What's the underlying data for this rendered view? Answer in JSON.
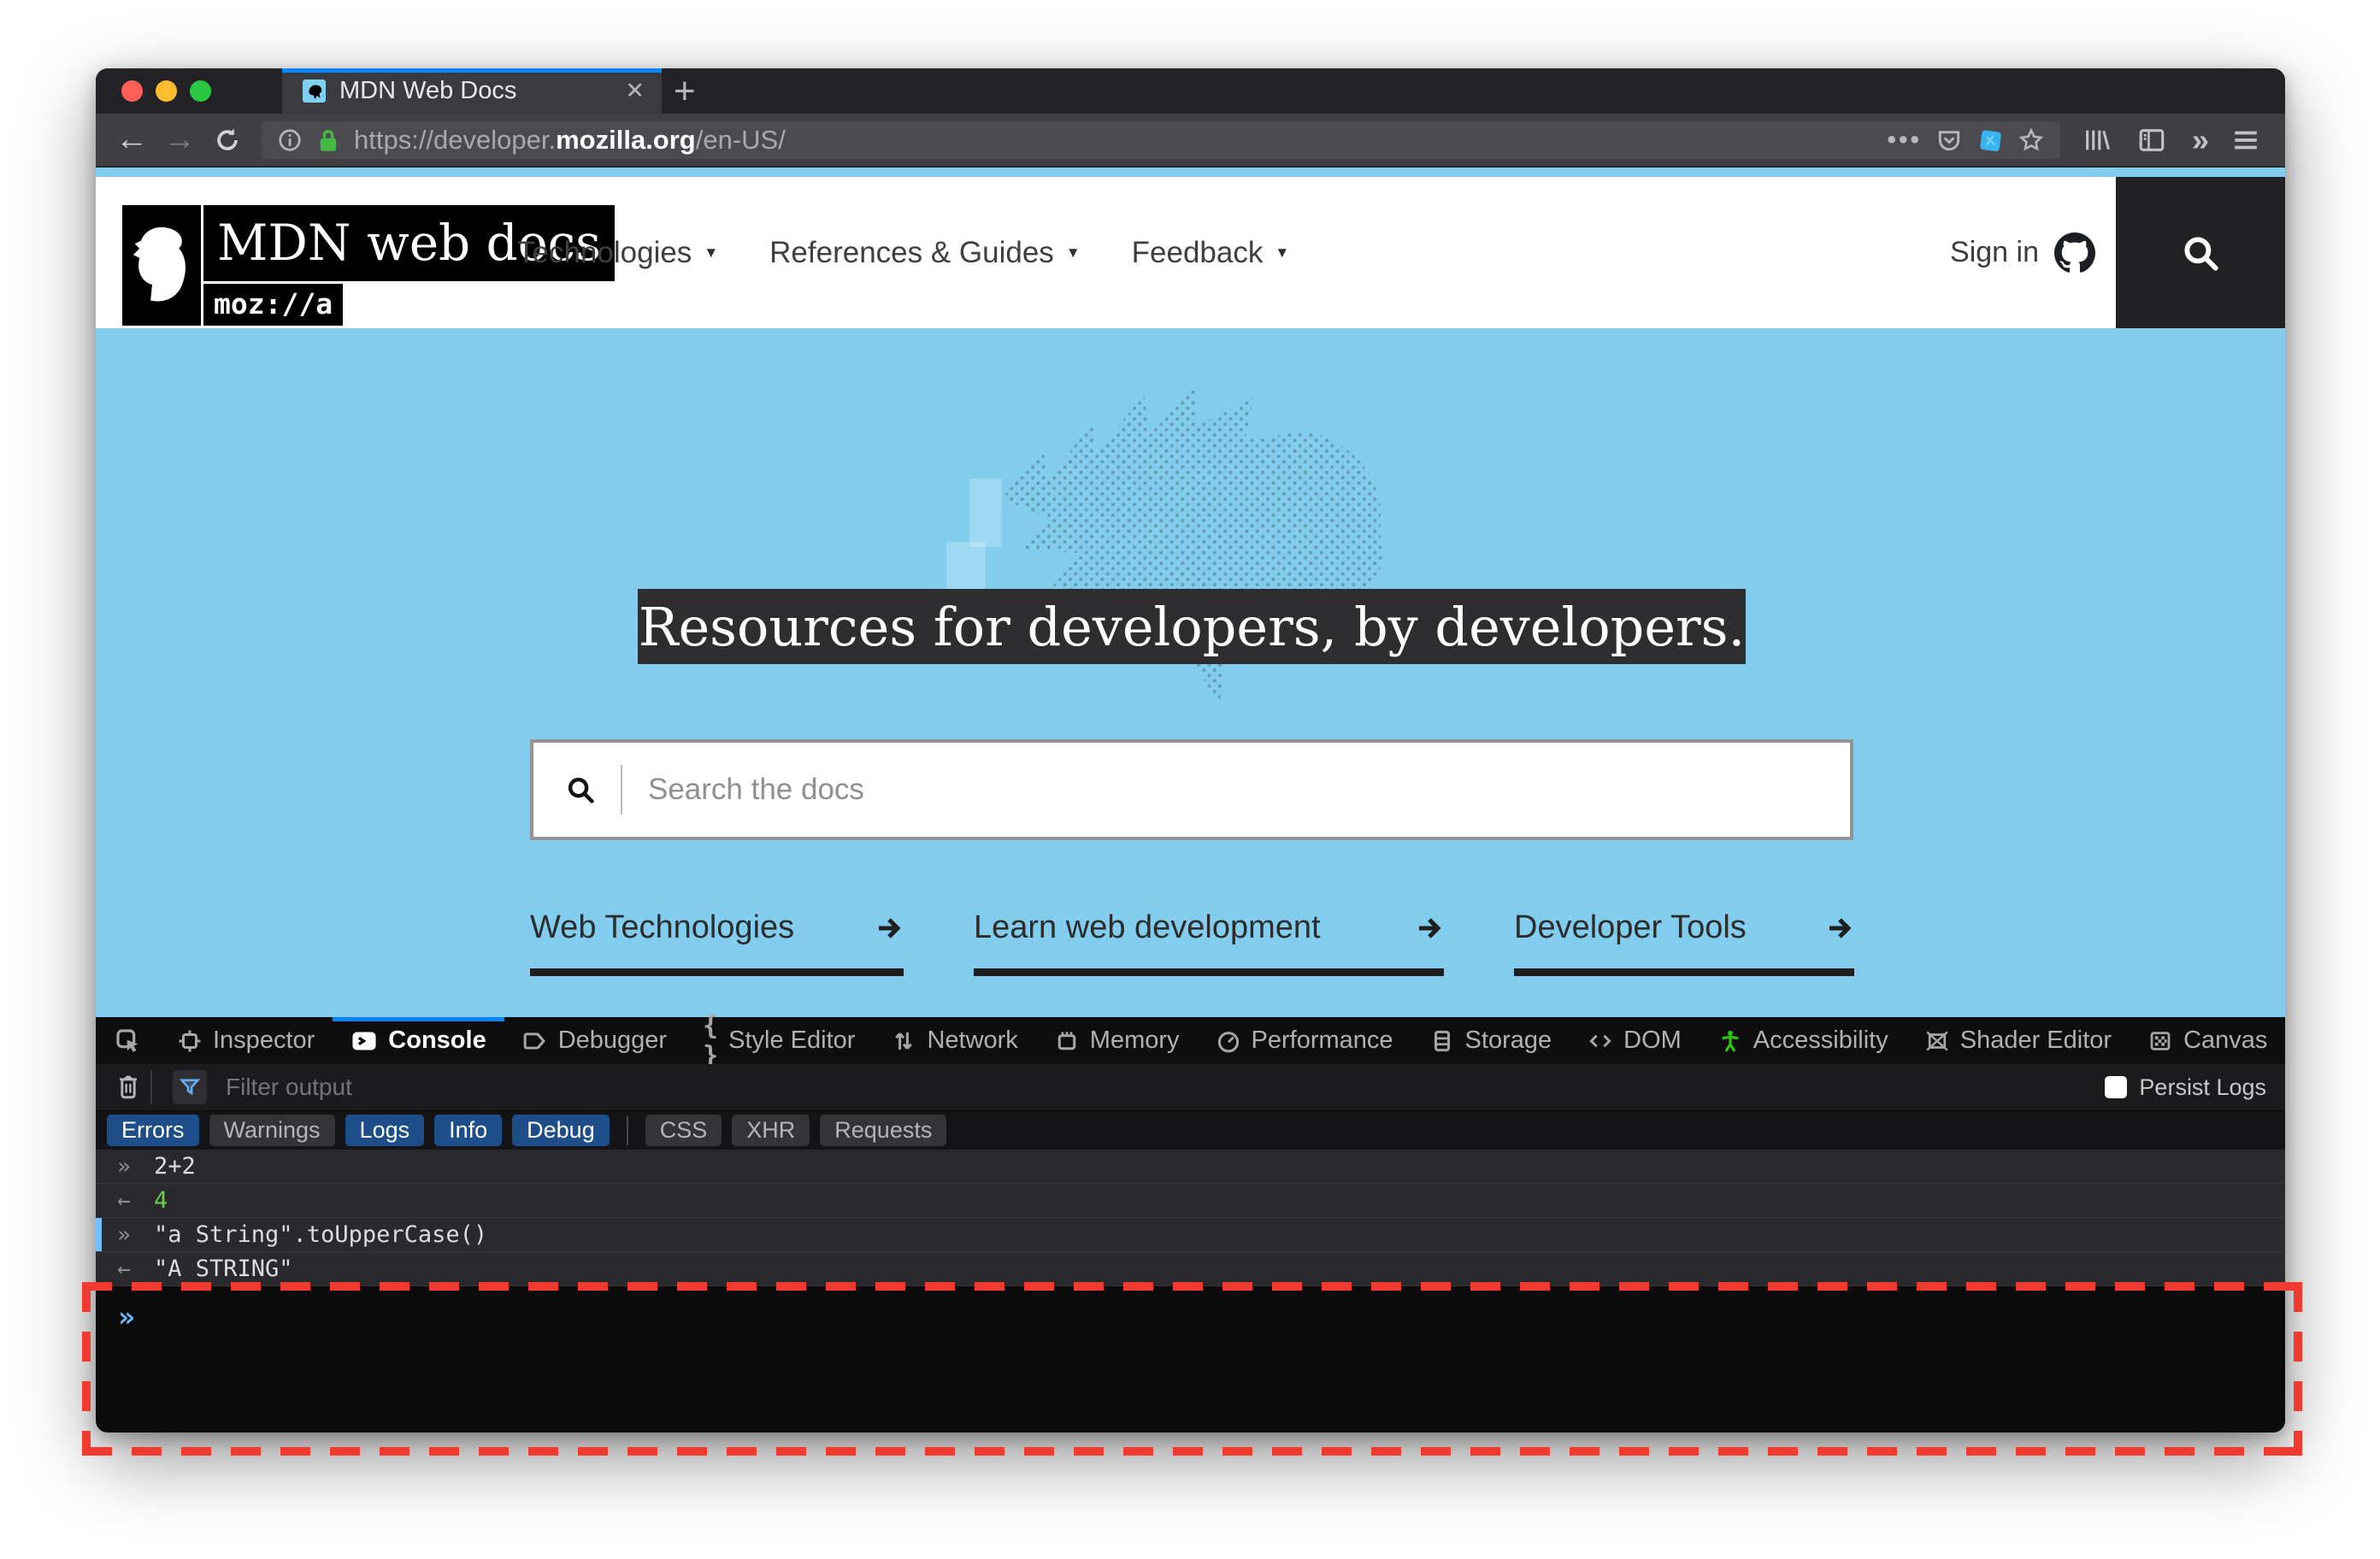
{
  "browser": {
    "tab_title": "MDN Web Docs",
    "tab_close": "✕",
    "new_tab": "+",
    "back": "←",
    "forward": "→",
    "url_scheme": "https://developer.",
    "url_domain": "mozilla.org",
    "url_path": "/en-US/",
    "page_actions_dots": "•••",
    "overflow_chevrons": "»"
  },
  "header": {
    "logo_title": "MDN web docs",
    "logo_sub": "moz://a",
    "caret": "▼",
    "nav": [
      {
        "label": "Technologies"
      },
      {
        "label": "References & Guides"
      },
      {
        "label": "Feedback"
      }
    ],
    "sign_in": "Sign in"
  },
  "hero": {
    "title": "Resources for developers, by developers.",
    "search_placeholder": "Search the docs",
    "links": [
      {
        "label": "Web Technologies"
      },
      {
        "label": "Learn web development"
      },
      {
        "label": "Developer Tools"
      }
    ]
  },
  "devtools": {
    "tabs": [
      {
        "label": "Inspector"
      },
      {
        "label": "Console"
      },
      {
        "label": "Debugger"
      },
      {
        "label": "Style Editor"
      },
      {
        "label": "Network"
      },
      {
        "label": "Memory"
      },
      {
        "label": "Performance"
      },
      {
        "label": "Storage"
      },
      {
        "label": "DOM"
      },
      {
        "label": "Accessibility"
      },
      {
        "label": "Shader Editor"
      },
      {
        "label": "Canvas"
      }
    ],
    "close": "✕",
    "menu_dots": "•••",
    "filter_placeholder": "Filter output",
    "persist_label": "Persist Logs",
    "filters": [
      {
        "label": "Errors"
      },
      {
        "label": "Warnings"
      },
      {
        "label": "Logs"
      },
      {
        "label": "Info"
      },
      {
        "label": "Debug"
      },
      {
        "label": "CSS"
      },
      {
        "label": "XHR"
      },
      {
        "label": "Requests"
      }
    ],
    "logs": [
      {
        "prompt": "»",
        "text": "2+2"
      },
      {
        "prompt": "←",
        "text": "4"
      },
      {
        "prompt": "»",
        "text": "\"a String\".toUpperCase()"
      },
      {
        "prompt": "←",
        "text": "\"A STRING\""
      }
    ],
    "input_prompt": "»"
  },
  "colors": {
    "accent_blue": "#0a84ff",
    "hero_blue": "#82cdee",
    "filter_on_blue": "#1d4e89",
    "result_green": "#6bcf52",
    "annotation_red": "#f23b30",
    "a11y_green": "#2fbf12"
  }
}
